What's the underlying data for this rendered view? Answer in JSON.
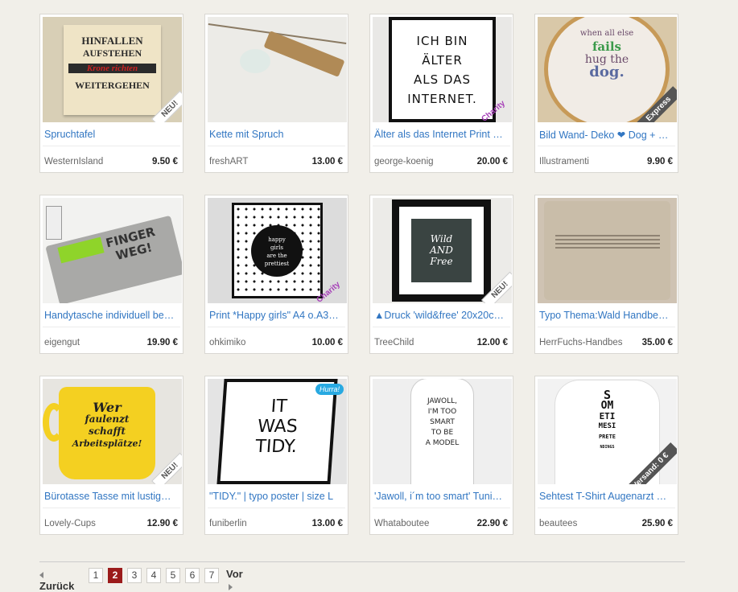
{
  "products": [
    {
      "title": "Spruchtafel",
      "shop": "WesternIsland",
      "price": "9.50 €",
      "badge": "NEU!",
      "badge_style": "light",
      "art": {
        "kind": "sign",
        "lines": [
          "HINFALLEN",
          "AUFSTEHEN",
          "Krone richten",
          "WEITERGEHEN"
        ],
        "bg": "#d8cfb6"
      }
    },
    {
      "title": "Kette mit Spruch",
      "shop": "freshART",
      "price": "13.00 €",
      "badge": "",
      "badge_style": "",
      "art": {
        "kind": "necklace",
        "bg": "#ecebe7"
      }
    },
    {
      "title": "Älter als das Internet Print …",
      "shop": "george-koenig",
      "price": "20.00 €",
      "badge": "Charity",
      "badge_style": "charity",
      "art": {
        "kind": "poster",
        "lines": [
          "ICH BIN",
          "ÄLTER",
          "ALS DAS",
          "INTERNET."
        ],
        "bg": "#e9e8e6"
      }
    },
    {
      "title": "Bild Wand- Deko ❤ Dog + …",
      "shop": "Illustramenti",
      "price": "9.90 €",
      "badge": "Express",
      "badge_style": "dark",
      "art": {
        "kind": "hoop",
        "lines": [
          "when all else",
          "fails",
          "hug the",
          "dog."
        ],
        "bg": "#d9c8a8"
      }
    },
    {
      "title": "Handytasche individuell be…",
      "shop": "eigengut",
      "price": "19.90 €",
      "badge": "",
      "badge_style": "",
      "art": {
        "kind": "felt",
        "lines": [
          "FINGER",
          "WEG!"
        ],
        "bg": "#f2f2f0"
      }
    },
    {
      "title": "Print *Happy girls\" A4 o.A3…",
      "shop": "ohkimiko",
      "price": "10.00 €",
      "badge": "Charity",
      "badge_style": "charity",
      "art": {
        "kind": "dots",
        "lines": [
          "happy",
          "girls",
          "are the",
          "prettiest"
        ],
        "bg": "#dcdcdc"
      }
    },
    {
      "title": "▲Druck 'wild&free' 20x20c…",
      "shop": "TreeChild",
      "price": "12.00 €",
      "badge": "NEU!",
      "badge_style": "light",
      "art": {
        "kind": "framed",
        "lines": [
          "Wild",
          "AND",
          "Free"
        ],
        "bg": "#ecebe8"
      }
    },
    {
      "title": "Typo Thema:Wald Handbe…",
      "shop": "HerrFuchs-Handbes",
      "price": "35.00 €",
      "badge": "",
      "badge_style": "",
      "art": {
        "kind": "pillow",
        "bg": "#cfc3b3"
      }
    },
    {
      "title": "Bürotasse Tasse mit lustig…",
      "shop": "Lovely-Cups",
      "price": "12.90 €",
      "badge": "NEU!",
      "badge_style": "light",
      "art": {
        "kind": "mug",
        "lines": [
          "Wer",
          "faulenzt",
          "schafft",
          "Arbeitsplätze!"
        ],
        "bg": "#e7e5e0"
      }
    },
    {
      "title": "\"TIDY.\" | typo poster | size L",
      "shop": "funiberlin",
      "price": "13.00 €",
      "badge": "Hurra!",
      "badge_style": "bubble",
      "art": {
        "kind": "tidy",
        "lines": [
          "IT",
          "WAS",
          "TIDY."
        ],
        "bg": "#e4e4e4"
      }
    },
    {
      "title": "'Jawoll, i´m too smart' Tuni…",
      "shop": "Whataboutee",
      "price": "22.90 €",
      "badge": "",
      "badge_style": "",
      "art": {
        "kind": "tank",
        "lines": [
          "JAWOLL,",
          "I'M TOO",
          "SMART",
          "TO BE",
          "A MODEL"
        ],
        "bg": "#efefef"
      }
    },
    {
      "title": "Sehtest T-Shirt Augenarzt …",
      "shop": "beautees",
      "price": "25.90 €",
      "badge": "Versand: 0 €",
      "badge_style": "dark",
      "art": {
        "kind": "shirt",
        "lines": [
          "S",
          "OM",
          "ETI",
          "MESI",
          "PRETE",
          "NDINGS"
        ],
        "bg": "#f2f2f2"
      }
    }
  ],
  "pagination": {
    "prev_label": "Zurück",
    "next_label": "Vor",
    "pages": [
      "1",
      "2",
      "3",
      "4",
      "5",
      "6",
      "7"
    ],
    "current": "2"
  },
  "icons": {
    "prev": "arrow-left-icon",
    "next": "arrow-right-icon"
  },
  "colors": {
    "link": "#3176c2",
    "active_page": "#9b1b1b",
    "background": "#f1efe9"
  }
}
